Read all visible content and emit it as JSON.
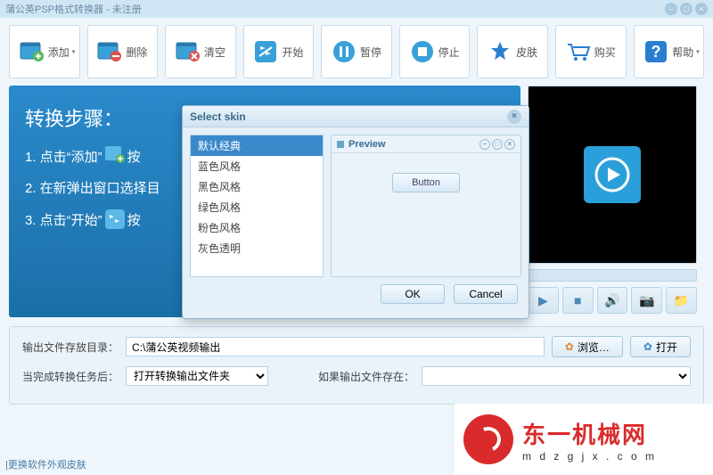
{
  "window": {
    "title": "蒲公英PSP格式转换器 - 未注册"
  },
  "toolbar": {
    "add": "添加",
    "delete": "删除",
    "clear": "清空",
    "start": "开始",
    "pause": "暂停",
    "stop": "停止",
    "skin": "皮肤",
    "buy": "购买",
    "help": "帮助"
  },
  "steps": {
    "title": "转换步骤：",
    "s1a": "1. 点击“添加”",
    "s1b": "按",
    "s2": "2. 在新弹出窗口选择目",
    "s3a": "3. 点击“开始”",
    "s3b": "按"
  },
  "dialog": {
    "title": "Select skin",
    "skins": [
      "默认经典",
      "蓝色风格",
      "黑色风格",
      "绿色风格",
      "粉色风格",
      "灰色透明"
    ],
    "selected": 0,
    "preview_title": "Preview",
    "preview_button": "Button",
    "ok": "OK",
    "cancel": "Cancel"
  },
  "output": {
    "dir_label": "输出文件存放目录：",
    "dir_value": "C:\\蒲公英视频输出",
    "browse": "浏览…",
    "open": "打开",
    "after_label": "当完成转换任务后：",
    "after_value": "打开转换输出文件夹",
    "exist_label": "如果输出文件存在："
  },
  "footer": {
    "link": "|更换软件外观皮肤"
  },
  "watermark": {
    "big": "东一机械网",
    "small": "m d z g j x . c o m"
  }
}
